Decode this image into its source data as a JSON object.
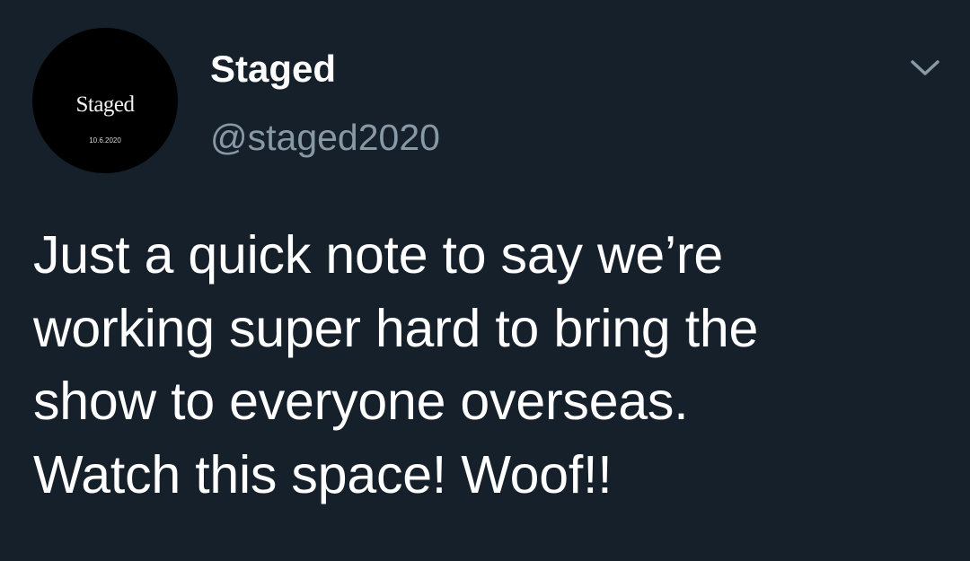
{
  "account": {
    "display_name": "Staged",
    "handle": "@staged2020",
    "avatar": {
      "title": "Staged",
      "date": "10.6.2020"
    }
  },
  "tweet": {
    "lines": [
      "Just a quick note to say we’re",
      "working super hard to bring the",
      "show to everyone overseas.",
      "Watch this space! Woof!!"
    ]
  },
  "icons": {
    "menu": "chevron-down-icon"
  },
  "colors": {
    "background": "#15202b",
    "text": "#ffffff",
    "secondary_text": "#8899a6",
    "avatar_bg": "#000000"
  }
}
